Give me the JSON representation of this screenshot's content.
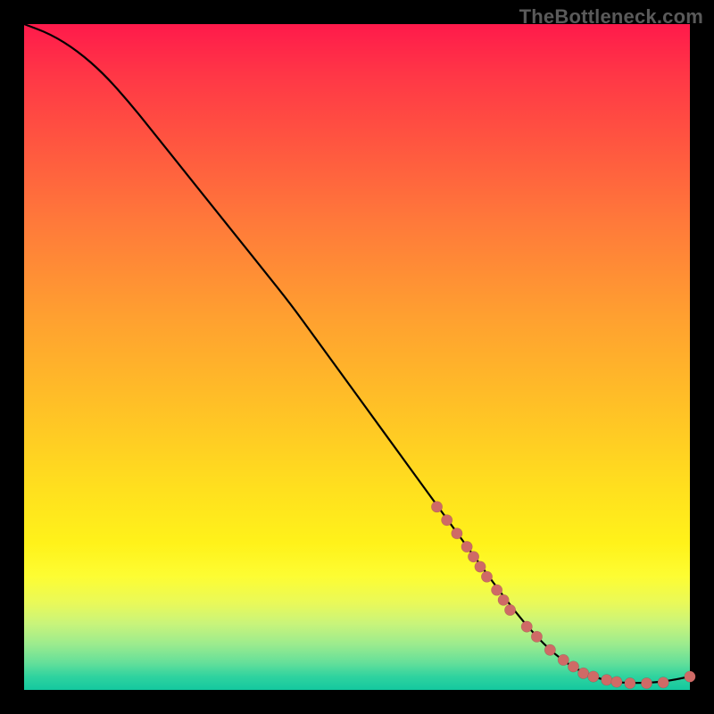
{
  "watermark": "TheBottleneck.com",
  "colors": {
    "marker": "#cf6a66",
    "curve": "#000000"
  },
  "chart_data": {
    "type": "line",
    "title": "",
    "xlabel": "",
    "ylabel": "",
    "xlim": [
      0,
      100
    ],
    "ylim": [
      0,
      100
    ],
    "grid": false,
    "legend": false,
    "series": [
      {
        "name": "curve",
        "x": [
          0,
          4,
          8,
          12,
          16,
          20,
          24,
          28,
          32,
          36,
          40,
          44,
          48,
          52,
          56,
          60,
          64,
          68,
          72,
          76,
          80,
          84,
          88,
          92,
          96,
          100
        ],
        "y": [
          100,
          98.5,
          96,
          92.5,
          88,
          83,
          78,
          73,
          68,
          63,
          58,
          52.5,
          47,
          41.5,
          36,
          30.5,
          25,
          19.5,
          14,
          9,
          5,
          2.5,
          1.2,
          1,
          1.2,
          2
        ]
      }
    ],
    "markers": {
      "name": "highlight-points",
      "x": [
        62,
        63.5,
        65,
        66.5,
        67.5,
        68.5,
        69.5,
        71,
        72,
        73,
        75.5,
        77,
        79,
        81,
        82.5,
        84,
        85.5,
        87.5,
        89,
        91,
        93.5,
        96,
        100
      ],
      "y": [
        27.5,
        25.5,
        23.5,
        21.5,
        20,
        18.5,
        17,
        15,
        13.5,
        12,
        9.5,
        8,
        6,
        4.5,
        3.5,
        2.5,
        2,
        1.5,
        1.2,
        1,
        1,
        1.1,
        2
      ],
      "r": 6.2
    }
  }
}
